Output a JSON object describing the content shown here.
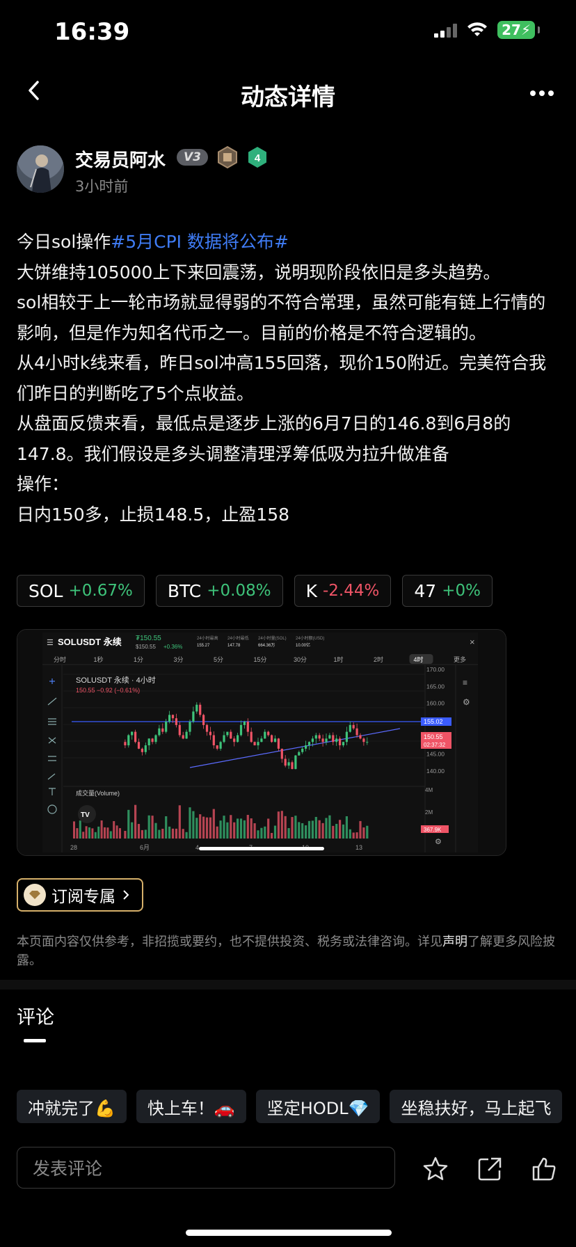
{
  "status": {
    "time": "16:39",
    "battery": "27"
  },
  "nav": {
    "title": "动态详情"
  },
  "author": {
    "name": "交易员阿水",
    "vip": "V3",
    "level": "4",
    "time": "3小时前"
  },
  "post": {
    "line1_prefix": "今日sol操作",
    "topic": "#5月CPI 数据将公布#",
    "paragraphs": [
      "大饼维持105000上下来回震荡，说明现阶段依旧是多头趋势。",
      "sol相较于上一轮市场就显得弱的不符合常理，虽然可能有链上行情的影响，但是作为知名代币之一。目前的价格是不符合逻辑的。",
      "从4小时k线来看，昨日sol冲高155回落，现价150附近。完美符合我们昨日的判断吃了5个点收益。",
      "从盘面反馈来看，最低点是逐步上涨的6月7日的146.8到6月8的147.8。我们假设是多头调整清理浮筹低吸为拉升做准备",
      "操作：",
      "日内150多，止损148.5，止盈158"
    ]
  },
  "tickers": [
    {
      "symbol": "SOL",
      "change": "+0.67%",
      "dir": "up"
    },
    {
      "symbol": "BTC",
      "change": "+0.08%",
      "dir": "up"
    },
    {
      "symbol": "K",
      "change": "-2.44%",
      "dir": "down"
    },
    {
      "symbol": "47",
      "change": "+0%",
      "dir": "up"
    }
  ],
  "chart": {
    "pair": "SOLUSDT 永续",
    "price_top": "₮150.55",
    "price_sub": "$150.55",
    "price_change": "+0.36%",
    "stats": [
      {
        "label": "24小时最高",
        "value": "155.27"
      },
      {
        "label": "24小时最低",
        "value": "147.78"
      },
      {
        "label": "24小时量(SOL)",
        "value": "664.36万"
      },
      {
        "label": "24小时额(USD)",
        "value": "10.00亿"
      }
    ],
    "timeframes": [
      "分时",
      "1秒",
      "1分",
      "3分",
      "5分",
      "15分",
      "30分",
      "1时",
      "2时",
      "4时",
      "更多"
    ],
    "active_timeframe": "4时",
    "legend_title": "SOLUSDT 永续 · 4小时",
    "legend_values": "150.55  −0.92 (−0.61%)",
    "y_ticks": [
      "170.00",
      "165.00",
      "160.00",
      "155.00",
      "150.00",
      "145.00",
      "140.00"
    ],
    "price_tag": "155.02",
    "last_tag": "150.55",
    "countdown": "02:37:32",
    "volume_label": "成交量(Volume)",
    "vol_ticks": [
      "4M",
      "2M"
    ],
    "vol_tag": "367.9K",
    "x_ticks": [
      "28",
      "6月",
      "4",
      "7",
      "10",
      "13"
    ]
  },
  "subscribe": {
    "label": "订阅专属"
  },
  "disclaimer": {
    "text": "本页面内容仅供参考，非招揽或要约，也不提供投资、税务或法律咨询。详见",
    "link": "声明",
    "tail": "了解更多风险披露。"
  },
  "comments": {
    "title": "评论"
  },
  "quick_replies": [
    "冲就完了💪",
    "快上车！🚗",
    "坚定HODL💎",
    "坐稳扶好，马上起飞"
  ],
  "comment_input": {
    "placeholder": "发表评论"
  },
  "colors": {
    "topic": "#3f7cf5",
    "up": "#3ec37a",
    "down": "#ef5466",
    "gold": "#d6b06a"
  }
}
